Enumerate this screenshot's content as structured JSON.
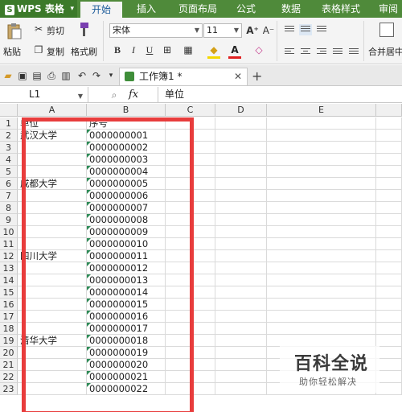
{
  "app": {
    "name": "WPS 表格"
  },
  "menu_tabs": [
    "开始",
    "插入",
    "页面布局",
    "公式",
    "数据",
    "表格样式",
    "审阅"
  ],
  "ribbon": {
    "paste": "粘贴",
    "cut": "剪切",
    "copy": "复制",
    "format_painter": "格式刷",
    "font_name": "宋体",
    "font_size": "11",
    "bold": "B",
    "italic": "I",
    "underline": "U",
    "merge_center": "合并居中"
  },
  "document": {
    "tab_title": "工作簿1 *"
  },
  "formula_bar": {
    "cell_ref": "L1",
    "fx": "fx",
    "content": "单位"
  },
  "columns": [
    "A",
    "B",
    "C",
    "D",
    "E"
  ],
  "rows": [
    {
      "n": "1",
      "a": "单位",
      "b": "序号"
    },
    {
      "n": "2",
      "a": "武汉大学",
      "b": "0000000001"
    },
    {
      "n": "3",
      "a": "",
      "b": "0000000002"
    },
    {
      "n": "4",
      "a": "",
      "b": "0000000003"
    },
    {
      "n": "5",
      "a": "",
      "b": "0000000004"
    },
    {
      "n": "6",
      "a": "成都大学",
      "b": "0000000005"
    },
    {
      "n": "7",
      "a": "",
      "b": "0000000006"
    },
    {
      "n": "8",
      "a": "",
      "b": "0000000007"
    },
    {
      "n": "9",
      "a": "",
      "b": "0000000008"
    },
    {
      "n": "10",
      "a": "",
      "b": "0000000009"
    },
    {
      "n": "11",
      "a": "",
      "b": "0000000010"
    },
    {
      "n": "12",
      "a": "四川大学",
      "b": "0000000011"
    },
    {
      "n": "13",
      "a": "",
      "b": "0000000012"
    },
    {
      "n": "14",
      "a": "",
      "b": "0000000013"
    },
    {
      "n": "15",
      "a": "",
      "b": "0000000014"
    },
    {
      "n": "16",
      "a": "",
      "b": "0000000015"
    },
    {
      "n": "17",
      "a": "",
      "b": "0000000016"
    },
    {
      "n": "18",
      "a": "",
      "b": "0000000017"
    },
    {
      "n": "19",
      "a": "清华大学",
      "b": "0000000018"
    },
    {
      "n": "20",
      "a": "",
      "b": "0000000019"
    },
    {
      "n": "21",
      "a": "",
      "b": "0000000020"
    },
    {
      "n": "22",
      "a": "",
      "b": "0000000021"
    },
    {
      "n": "23",
      "a": "",
      "b": "0000000022"
    }
  ],
  "watermark": {
    "title": "百科全说",
    "subtitle": "助你轻松解决"
  },
  "colors": {
    "tab_bar": "#4f8a3a",
    "highlight_box": "#e83c3c"
  }
}
